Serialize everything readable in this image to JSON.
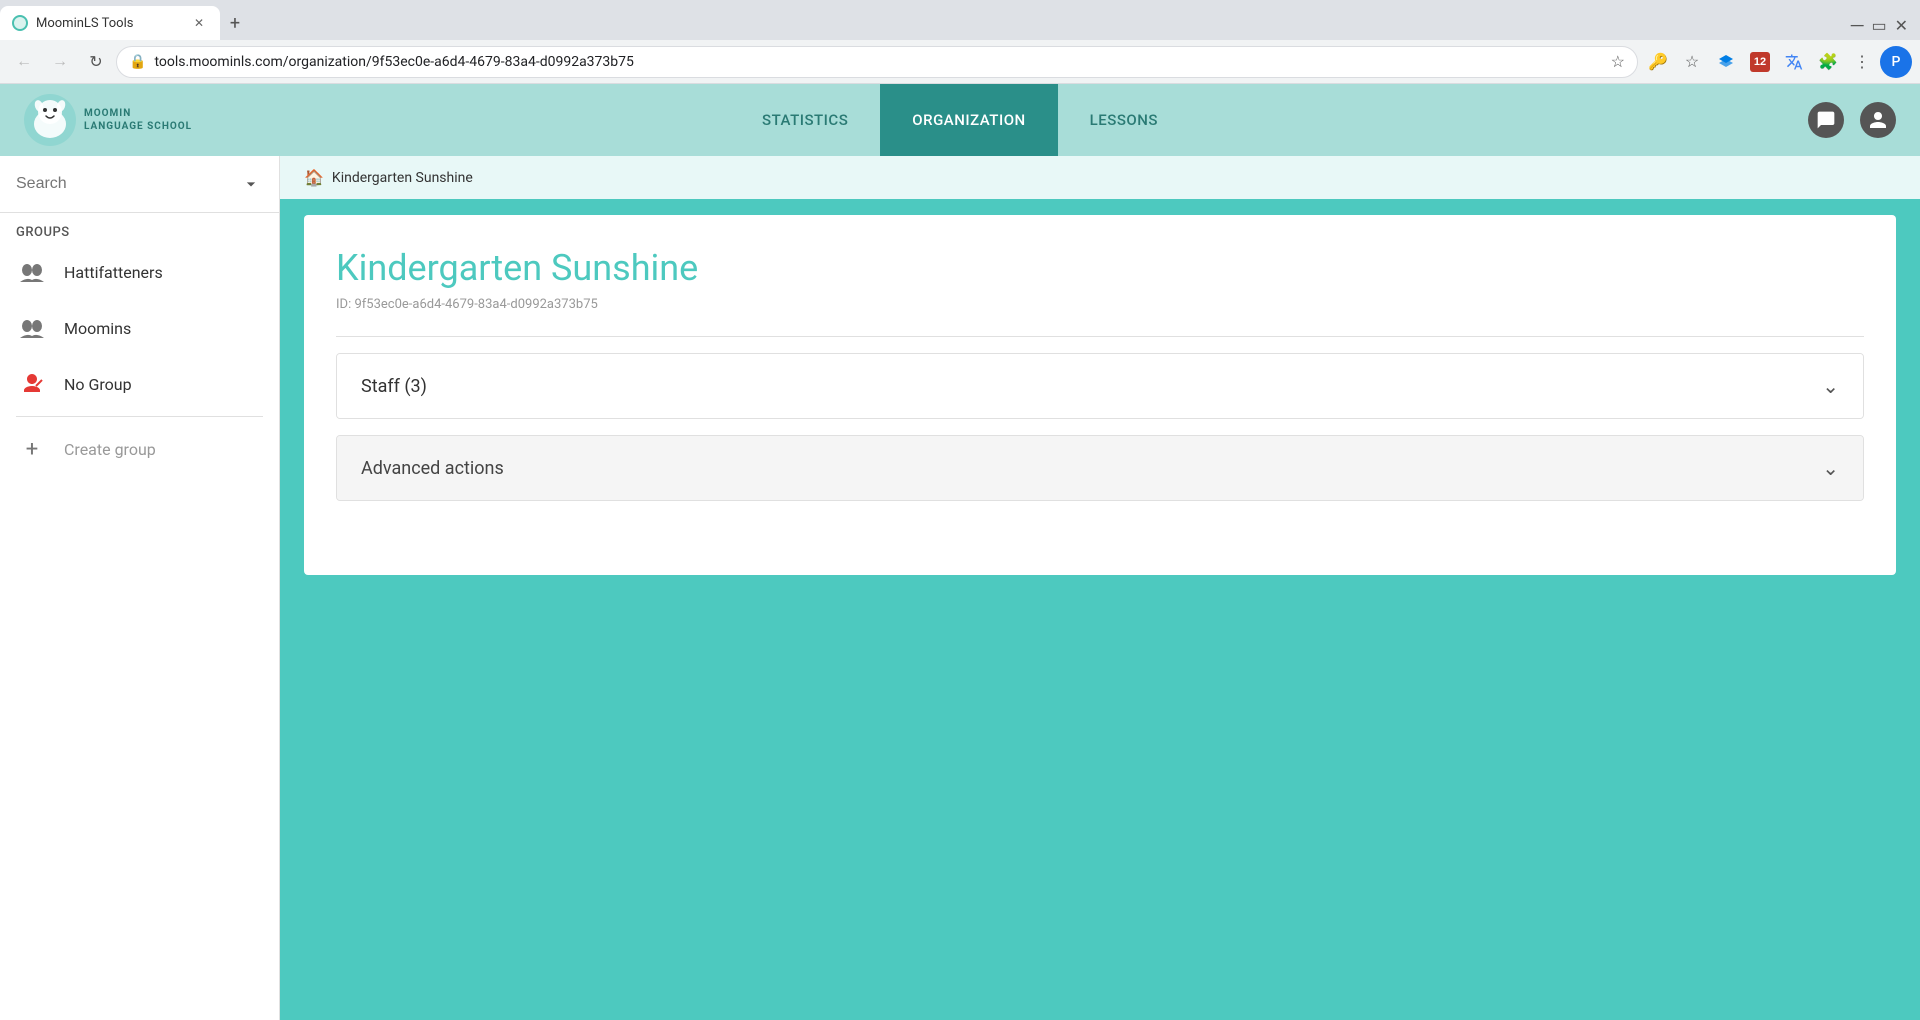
{
  "browser": {
    "tab_title": "MoominLS Tools",
    "tab_favicon": "🌊",
    "url": "tools.moominls.com/organization/9f53ec0e-a6d4-4679-83a4-d0992a373b75",
    "new_tab_label": "+",
    "back_disabled": false,
    "forward_disabled": true
  },
  "nav": {
    "logo_text": "MOOMIN\nLANGUAGE SCHOOL",
    "links": [
      {
        "id": "statistics",
        "label": "STATISTICS",
        "active": false
      },
      {
        "id": "organization",
        "label": "ORGANIZATION",
        "active": true
      },
      {
        "id": "lessons",
        "label": "LESSONS",
        "active": false
      }
    ]
  },
  "sidebar": {
    "search_placeholder": "Search",
    "groups_label": "Groups",
    "items": [
      {
        "id": "hattifatteners",
        "label": "Hattifatteners",
        "icon": "people"
      },
      {
        "id": "moomins",
        "label": "Moomins",
        "icon": "people"
      },
      {
        "id": "no-group",
        "label": "No Group",
        "icon": "person-red"
      }
    ],
    "create_group_label": "Create group"
  },
  "page": {
    "breadcrumb": "Kindergarten Sunshine",
    "org_title": "Kindergarten Sunshine",
    "org_id": "ID: 9f53ec0e-a6d4-4679-83a4-d0992a373b75",
    "staff_section_label": "Staff (3)",
    "advanced_section_label": "Advanced actions"
  },
  "colors": {
    "teal": "#4dc9bf",
    "teal_dark": "#2a8f89",
    "teal_light": "#a8ddd8"
  }
}
